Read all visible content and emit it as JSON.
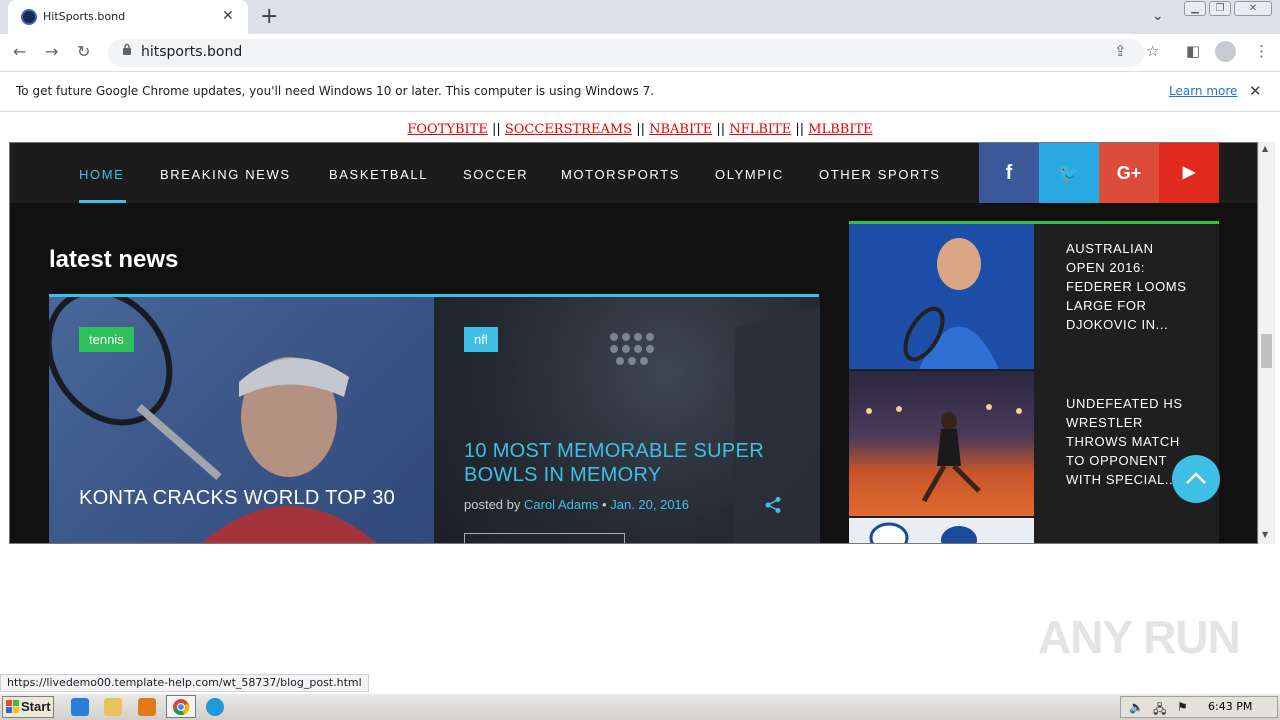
{
  "browser": {
    "tab_title": "HitSports.bond",
    "url": "hitsports.bond",
    "infobar_text": "To get future Google Chrome updates, you'll need Windows 10 or later. This computer is using Windows 7.",
    "learn_more": "Learn more"
  },
  "top_links": [
    "FOOTYBITE",
    "SOCCERSTREAMS",
    "NBABITE",
    "NFLBITE",
    "MLBBITE"
  ],
  "top_links_separator": "||",
  "nav": {
    "items": [
      "HOME",
      "BREAKING NEWS",
      "BASKETBALL",
      "SOCCER",
      "MOTORSPORTS",
      "OLYMPIC",
      "OTHER SPORTS"
    ],
    "social": [
      {
        "name": "facebook",
        "glyph": "f",
        "color": "#3b5998"
      },
      {
        "name": "twitter",
        "glyph": "🐦",
        "color": "#29a9e1"
      },
      {
        "name": "google-plus",
        "glyph": "G+",
        "color": "#dd4b39"
      },
      {
        "name": "youtube",
        "glyph": "▶",
        "color": "#e02a20"
      }
    ]
  },
  "main": {
    "heading": "latest news",
    "card1": {
      "badge": "tennis",
      "title": "KONTA CRACKS WORLD TOP 30"
    },
    "card2": {
      "badge": "nfl",
      "title": "10 MOST MEMORABLE SUPER BOWLS IN MEMORY",
      "posted_by": "posted by",
      "author": "Carol Adams",
      "date": "Jan. 20, 2016"
    }
  },
  "sidebar": {
    "items": [
      {
        "title": "AUSTRALIAN OPEN 2016: FEDERER LOOMS LARGE FOR DJOKOVIC IN..."
      },
      {
        "title": "UNDEFEATED HS WRESTLER THROWS MATCH TO OPPONENT WITH SPECIAL..."
      }
    ]
  },
  "status_url": "https://livedemo00.template-help.com/wt_58737/blog_post.html",
  "watermark": "ANY RUN",
  "taskbar": {
    "start": "Start",
    "clock": "6:43 PM"
  },
  "colors": {
    "accent": "#3ec0e6",
    "tennis_badge": "#2ec05a",
    "nfl_badge": "#3ec0e6",
    "sidebar_rule": "#2fbf4a"
  }
}
